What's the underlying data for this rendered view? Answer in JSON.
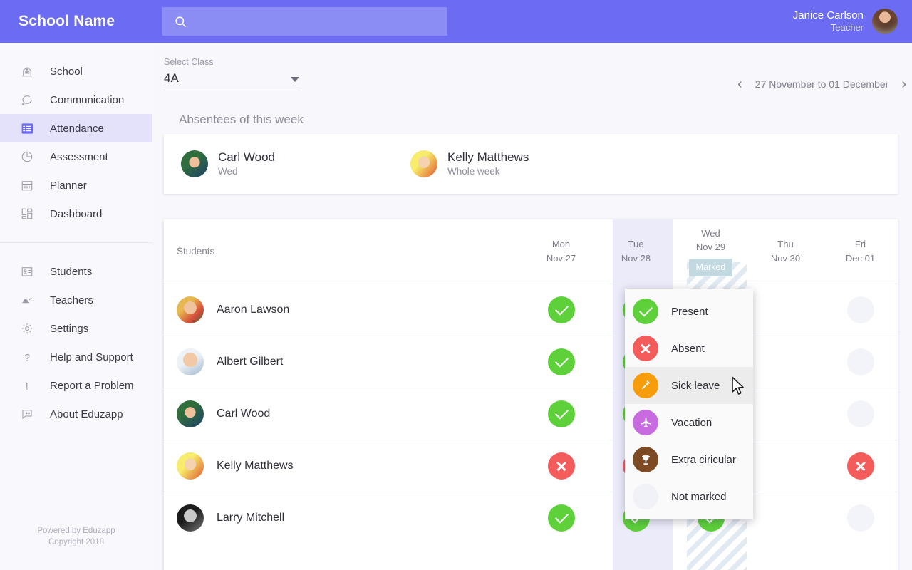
{
  "topbar": {
    "brand": "School Name",
    "search_placeholder": "",
    "search_value": "",
    "search_icon": "search-icon",
    "user_name": "Janice Carlson",
    "user_role": "Teacher",
    "brand_color": "#6C6CF2"
  },
  "sidebar": {
    "group1": [
      {
        "label": "School",
        "icon": "school-building-icon",
        "active": false
      },
      {
        "label": "Communication",
        "icon": "chat-bubble-icon",
        "active": false
      },
      {
        "label": "Attendance",
        "icon": "checklist-icon",
        "active": true
      },
      {
        "label": "Assessment",
        "icon": "pie-chart-icon",
        "active": false
      },
      {
        "label": "Planner",
        "icon": "calendar-icon",
        "active": false
      },
      {
        "label": "Dashboard",
        "icon": "dashboard-grid-icon",
        "active": false
      }
    ],
    "group2": [
      {
        "label": "Students",
        "icon": "id-card-icon",
        "active": false
      },
      {
        "label": "Teachers",
        "icon": "teacher-desk-icon",
        "active": false
      },
      {
        "label": "Settings",
        "icon": "gear-icon",
        "active": false
      },
      {
        "label": "Help and Support",
        "icon": "question-mark-icon",
        "active": false
      },
      {
        "label": "Report a Problem",
        "icon": "exclamation-mark-icon",
        "active": false
      },
      {
        "label": "About Eduzapp",
        "icon": "info-chat-icon",
        "active": false
      }
    ],
    "footer_line1": "Powered by Eduzapp",
    "footer_line2": "Copyright 2018",
    "active_bg": "#e4e2fb"
  },
  "class_select": {
    "label": "Select Class",
    "value": "4A",
    "caret_icon": "chevron-down-icon"
  },
  "week_nav": {
    "prev_icon": "chevron-left-icon",
    "next_icon": "chevron-right-icon",
    "range": "27 November to 01 December"
  },
  "absentees": {
    "title": "Absentees of this week",
    "items": [
      {
        "name": "Carl Wood",
        "detail": "Wed",
        "photo": "boy3"
      },
      {
        "name": "Kelly Matthews",
        "detail": "Whole week",
        "photo": "girl1"
      }
    ]
  },
  "attendance_table": {
    "students_header": "Students",
    "days": [
      {
        "day": "Mon",
        "date": "Nov 27",
        "badge": "",
        "state": "normal"
      },
      {
        "day": "Tue",
        "date": "Nov 28",
        "badge": "",
        "state": "normal"
      },
      {
        "day": "Wed",
        "date": "Nov 29",
        "badge": "Marked",
        "state": "selected"
      },
      {
        "day": "Thu",
        "date": "Nov 30",
        "badge": "",
        "state": "hatched"
      },
      {
        "day": "Fri",
        "date": "Dec 01",
        "badge": "",
        "state": "normal"
      }
    ],
    "badge_color": "#c3d9e1",
    "rows": [
      {
        "name": "Aaron Lawson",
        "photo": "boy1",
        "marks": [
          "present",
          "present",
          "present",
          "blank",
          "notmarked"
        ]
      },
      {
        "name": "Albert Gilbert",
        "photo": "boy2",
        "marks": [
          "present",
          "present",
          "present",
          "blank",
          "notmarked"
        ]
      },
      {
        "name": "Carl Wood",
        "photo": "boy3",
        "marks": [
          "present",
          "present",
          "absent",
          "blank",
          "notmarked"
        ]
      },
      {
        "name": "Kelly Matthews",
        "photo": "girl1",
        "marks": [
          "absent",
          "absent",
          "absent",
          "blank",
          "absent"
        ]
      },
      {
        "name": "Larry Mitchell",
        "photo": "boy4",
        "marks": [
          "present",
          "present",
          "present",
          "blank",
          "notmarked"
        ]
      }
    ],
    "mark_colors": {
      "present": "#5ed13a",
      "absent": "#f45b5b",
      "notmarked": "#f3f3fa"
    }
  },
  "status_menu": {
    "hovered": "Sick leave",
    "cursor_icon": "mouse-pointer-icon",
    "items": [
      {
        "label": "Present",
        "icon": "check-circle-icon",
        "color": "#5ed13a"
      },
      {
        "label": "Absent",
        "icon": "x-circle-icon",
        "color": "#f45b5b"
      },
      {
        "label": "Sick leave",
        "icon": "thermometer-icon",
        "color": "#f79d0c"
      },
      {
        "label": "Vacation",
        "icon": "airplane-icon",
        "color": "#c86be0"
      },
      {
        "label": "Extra ciricular",
        "icon": "trophy-icon",
        "color": "#7d4a23"
      },
      {
        "label": "Not marked",
        "icon": "empty-circle-icon",
        "color": "#f1f1f8"
      }
    ]
  }
}
